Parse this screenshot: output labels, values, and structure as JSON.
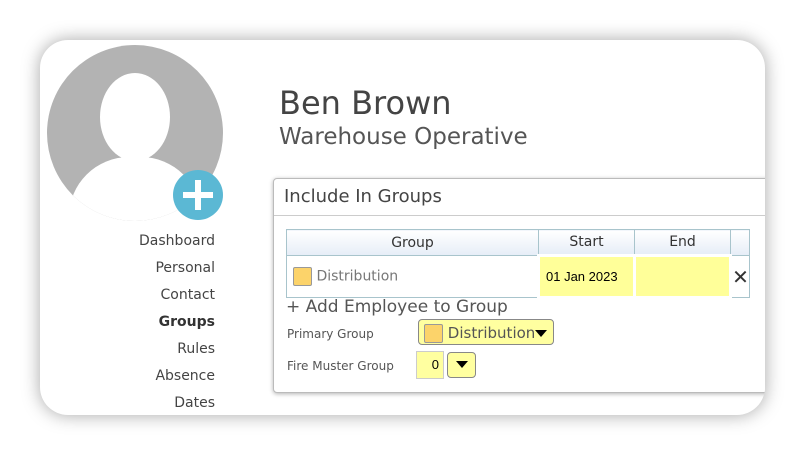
{
  "profile": {
    "name": "Ben Brown",
    "role": "Warehouse Operative"
  },
  "nav": [
    {
      "label": "Dashboard"
    },
    {
      "label": "Personal"
    },
    {
      "label": "Contact"
    },
    {
      "label": "Groups"
    },
    {
      "label": "Rules"
    },
    {
      "label": "Absence"
    },
    {
      "label": "Dates"
    }
  ],
  "panel": {
    "title": "Include In Groups",
    "columns": [
      "Group",
      "Start",
      "End"
    ],
    "rows": [
      {
        "group": "Distribution",
        "start": "01 Jan 2023",
        "end": ""
      }
    ],
    "add_link": "+ Add Employee to Group",
    "primary_label": "Primary Group",
    "primary_value": "Distribution",
    "fire_label": "Fire Muster Group",
    "fire_value": "0"
  },
  "colors": {
    "accent": "#5bb8d4",
    "group_swatch": "#fcd36a",
    "field": "#ffff99"
  }
}
